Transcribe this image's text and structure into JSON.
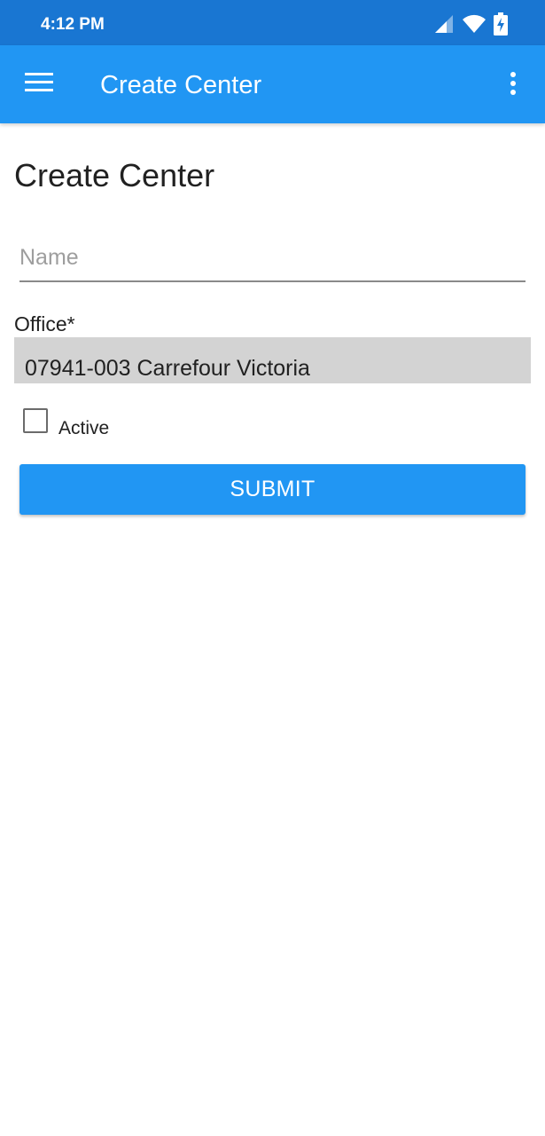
{
  "status_bar": {
    "time": "4:12 PM",
    "icons": [
      "signal-icon",
      "wifi-icon",
      "battery-charging-icon"
    ]
  },
  "app_bar": {
    "title": "Create Center",
    "menu_icon": "hamburger-menu-icon",
    "overflow_icon": "more-vert-icon",
    "color": "#2196f3"
  },
  "form": {
    "heading": "Create Center",
    "name_placeholder": "Name",
    "name_value": "",
    "office_label": "Office*",
    "office_selected": "07941-003 Carrefour Victoria",
    "active_label": "Active",
    "active_checked": false,
    "submit_label": "SUBMIT"
  },
  "colors": {
    "status_bar": "#1976d2",
    "accent": "#2196f3",
    "select_bg": "#d3d3d3"
  }
}
